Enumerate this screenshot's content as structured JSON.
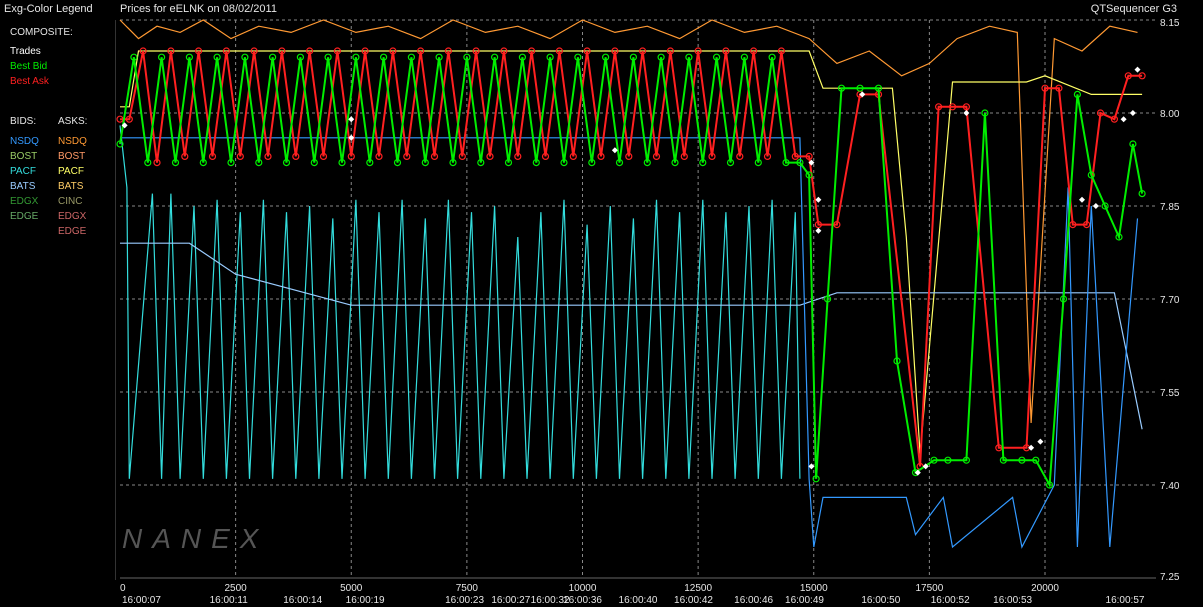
{
  "header": {
    "legend_title": "Exg-Color Legend",
    "chart_title": "Prices for  eELNK  on  08/02/2011",
    "app_name": "QTSequencer G3"
  },
  "legend": {
    "composite_heading": "COMPOSITE:",
    "composite": [
      {
        "label": "Trades",
        "color": "#ffffff"
      },
      {
        "label": "Best Bid",
        "color": "#00ee00"
      },
      {
        "label": "Best Ask",
        "color": "#ff2020"
      }
    ],
    "bids_heading": "BIDS:",
    "asks_heading": "ASKS:",
    "bids": [
      {
        "label": "NSDQ",
        "color": "#3399ff"
      },
      {
        "label": "BOST",
        "color": "#99cc66"
      },
      {
        "label": "PACF",
        "color": "#33dddd"
      },
      {
        "label": "BATS",
        "color": "#99ccff"
      },
      {
        "label": "EDGX",
        "color": "#339933"
      },
      {
        "label": "EDGE",
        "color": "#66aa66"
      }
    ],
    "asks": [
      {
        "label": "NSDQ",
        "color": "#ff9933"
      },
      {
        "label": "BOST",
        "color": "#ff9966"
      },
      {
        "label": "PACF",
        "color": "#ffff66"
      },
      {
        "label": "BATS",
        "color": "#ffcc66"
      },
      {
        "label": "CINC",
        "color": "#999966"
      },
      {
        "label": "EDGX",
        "color": "#cc6666"
      },
      {
        "label": "EDGE",
        "color": "#cc6666"
      }
    ]
  },
  "watermark": "NANEX",
  "chart_data": {
    "type": "line",
    "xlim": [
      0,
      22400
    ],
    "ylim": [
      7.25,
      8.15
    ],
    "grid": true,
    "x_ticks": [
      {
        "x": 0,
        "label": "0"
      },
      {
        "x": 2500,
        "label": "2500"
      },
      {
        "x": 5000,
        "label": "5000"
      },
      {
        "x": 7500,
        "label": "7500"
      },
      {
        "x": 10000,
        "label": "10000"
      },
      {
        "x": 12500,
        "label": "12500"
      },
      {
        "x": 15000,
        "label": "15000"
      },
      {
        "x": 17500,
        "label": "17500"
      },
      {
        "x": 20000,
        "label": "20000"
      }
    ],
    "time_ticks": [
      {
        "x": 0,
        "label": "16:00:07"
      },
      {
        "x": 2350,
        "label": "16:00:11"
      },
      {
        "x": 3950,
        "label": "16:00:14"
      },
      {
        "x": 5300,
        "label": "16:00:19"
      },
      {
        "x": 7450,
        "label": "16:00:23"
      },
      {
        "x": 8450,
        "label": "16:00:27"
      },
      {
        "x": 9300,
        "label": "16:00:32"
      },
      {
        "x": 10000,
        "label": "16:00:36"
      },
      {
        "x": 11200,
        "label": "16:00:40"
      },
      {
        "x": 12400,
        "label": "16:00:42"
      },
      {
        "x": 13700,
        "label": "16:00:46"
      },
      {
        "x": 14800,
        "label": "16:00:49"
      },
      {
        "x": 16450,
        "label": "16:00:50"
      },
      {
        "x": 17950,
        "label": "16:00:52"
      },
      {
        "x": 19300,
        "label": "16:00:53"
      },
      {
        "x": 22000,
        "label": "16:00:57"
      }
    ],
    "y_ticks": [
      {
        "y": 8.15,
        "label": "8.15"
      },
      {
        "y": 8.0,
        "label": "8.00"
      },
      {
        "y": 7.85,
        "label": "7.85"
      },
      {
        "y": 7.7,
        "label": "7.70"
      },
      {
        "y": 7.55,
        "label": "7.55"
      },
      {
        "y": 7.4,
        "label": "7.40"
      },
      {
        "y": 7.25,
        "label": "7.25"
      }
    ],
    "series": [
      {
        "name": "Best Bid",
        "color": "#00ee00",
        "x": [
          0,
          300,
          600,
          900,
          1200,
          1500,
          1800,
          2100,
          2400,
          2700,
          3000,
          3300,
          3600,
          3900,
          4200,
          4500,
          4800,
          5100,
          5400,
          5700,
          6000,
          6300,
          6600,
          6900,
          7200,
          7500,
          7800,
          8100,
          8400,
          8700,
          9000,
          9300,
          9600,
          9900,
          10200,
          10500,
          10800,
          11100,
          11400,
          11700,
          12000,
          12300,
          12600,
          12900,
          13200,
          13500,
          13800,
          14100,
          14400,
          14700,
          14900,
          15050,
          15300,
          15600,
          16000,
          16400,
          16800,
          17200,
          17600,
          17900,
          18300,
          18700,
          19100,
          19500,
          19800,
          20100,
          20400,
          20700,
          21000,
          21300,
          21600,
          21900,
          22100
        ],
        "values": [
          7.95,
          8.09,
          7.92,
          8.09,
          7.92,
          8.09,
          7.92,
          8.09,
          7.92,
          8.09,
          7.92,
          8.09,
          7.92,
          8.09,
          7.92,
          8.09,
          7.92,
          8.09,
          7.92,
          8.09,
          7.92,
          8.09,
          7.92,
          8.09,
          7.92,
          8.09,
          7.92,
          8.09,
          7.92,
          8.09,
          7.92,
          8.09,
          7.92,
          8.09,
          7.92,
          8.09,
          7.92,
          8.09,
          7.92,
          8.09,
          7.92,
          8.09,
          7.92,
          8.09,
          7.92,
          8.09,
          7.92,
          8.09,
          7.92,
          7.92,
          7.9,
          7.41,
          7.7,
          8.04,
          8.04,
          8.04,
          7.6,
          7.42,
          7.44,
          7.44,
          7.44,
          8.0,
          7.44,
          7.44,
          7.44,
          7.4,
          7.7,
          8.03,
          7.9,
          7.85,
          7.8,
          7.95,
          7.87
        ]
      },
      {
        "name": "Best Ask",
        "color": "#ff2020",
        "x": [
          0,
          200,
          500,
          800,
          1100,
          1400,
          1700,
          2000,
          2300,
          2600,
          2900,
          3200,
          3500,
          3800,
          4100,
          4400,
          4700,
          5000,
          5300,
          5600,
          5900,
          6200,
          6500,
          6800,
          7100,
          7400,
          7700,
          8000,
          8300,
          8600,
          8900,
          9200,
          9500,
          9800,
          10100,
          10400,
          10700,
          11000,
          11300,
          11600,
          11900,
          12200,
          12500,
          12800,
          13100,
          13400,
          13700,
          14000,
          14300,
          14600,
          14900,
          15100,
          15500,
          16000,
          16400,
          17300,
          17700,
          18000,
          18300,
          19000,
          19600,
          20000,
          20300,
          20600,
          20900,
          21200,
          21500,
          21800,
          22100
        ],
        "values": [
          7.99,
          7.99,
          8.1,
          7.92,
          8.1,
          7.93,
          8.1,
          7.93,
          8.1,
          7.93,
          8.1,
          7.93,
          8.1,
          7.93,
          8.1,
          7.93,
          8.1,
          7.93,
          8.1,
          7.93,
          8.1,
          7.93,
          8.1,
          7.93,
          8.1,
          7.93,
          8.1,
          7.93,
          8.1,
          7.93,
          8.1,
          7.93,
          8.1,
          7.93,
          8.1,
          7.93,
          8.1,
          7.93,
          8.1,
          7.93,
          8.1,
          7.93,
          8.1,
          7.93,
          8.1,
          7.93,
          8.1,
          7.93,
          8.1,
          7.93,
          7.93,
          7.82,
          7.82,
          8.03,
          8.03,
          7.43,
          8.01,
          8.01,
          8.01,
          7.46,
          7.46,
          8.04,
          8.04,
          7.82,
          7.82,
          8.0,
          7.99,
          8.06,
          8.06
        ]
      },
      {
        "name": "PACF",
        "color": "#33dddd",
        "x": [
          0,
          150,
          200,
          700,
          900,
          1100,
          1300,
          1600,
          1800,
          2100,
          2300,
          2600,
          2800,
          3100,
          3300,
          3600,
          3800,
          4100,
          4300,
          4600,
          4800,
          5100,
          5300,
          5600,
          5800,
          6100,
          6300,
          6600,
          6800,
          7100,
          7300,
          7600,
          7800,
          8100,
          8300,
          8600,
          8800,
          9100,
          9300,
          9600,
          9800,
          10100,
          10300,
          10600,
          10800,
          11100,
          11300,
          11600,
          11800,
          12100,
          12300,
          12600,
          12800,
          13100,
          13300,
          13600,
          13800,
          14100,
          14300,
          14600,
          14700
        ],
        "values": [
          7.98,
          7.88,
          7.41,
          7.87,
          7.41,
          7.87,
          7.41,
          7.85,
          7.41,
          7.86,
          7.41,
          7.84,
          7.41,
          7.86,
          7.41,
          7.84,
          7.41,
          7.85,
          7.41,
          7.83,
          7.41,
          7.86,
          7.41,
          7.84,
          7.41,
          7.86,
          7.41,
          7.83,
          7.41,
          7.86,
          7.41,
          7.84,
          7.41,
          7.85,
          7.41,
          7.8,
          7.41,
          7.84,
          7.41,
          7.86,
          7.41,
          7.82,
          7.41,
          7.85,
          7.41,
          7.83,
          7.41,
          7.86,
          7.41,
          7.84,
          7.41,
          7.86,
          7.41,
          7.84,
          7.41,
          7.85,
          7.41,
          7.86,
          7.41,
          7.84,
          7.41
        ]
      },
      {
        "name": "NSDQ Ask",
        "color": "#ff9933",
        "x": [
          0,
          400,
          800,
          1300,
          1800,
          2400,
          3000,
          3700,
          4400,
          5100,
          5800,
          6500,
          7200,
          7900,
          8600,
          9300,
          10000,
          10700,
          11400,
          12100,
          12800,
          13500,
          14200,
          14900,
          15500,
          16200,
          16900,
          17500,
          18100,
          18800,
          19400,
          19700,
          20200,
          20800,
          21400,
          22000
        ],
        "values": [
          8.15,
          8.12,
          8.14,
          8.13,
          8.15,
          8.12,
          8.14,
          8.13,
          8.15,
          8.13,
          8.14,
          8.12,
          8.15,
          8.13,
          8.14,
          8.12,
          8.15,
          8.13,
          8.14,
          8.12,
          8.15,
          8.13,
          8.14,
          8.12,
          8.08,
          8.1,
          8.06,
          8.08,
          8.12,
          8.14,
          8.13,
          7.5,
          8.12,
          8.1,
          8.14,
          8.13
        ]
      },
      {
        "name": "PACF Ask",
        "color": "#ffff66",
        "x": [
          0,
          200,
          400,
          14900,
          15200,
          16000,
          16700,
          17000,
          17300,
          18000,
          19000,
          19600,
          20000,
          21000,
          22100
        ],
        "values": [
          8.01,
          8.01,
          8.1,
          8.1,
          8.04,
          8.04,
          8.04,
          7.8,
          7.45,
          8.05,
          8.05,
          8.05,
          8.06,
          8.03,
          8.03
        ]
      },
      {
        "name": "NSDQ Bid",
        "color": "#3399ff",
        "x": [
          0,
          14700,
          14900,
          15000,
          15200,
          17000,
          17200,
          17800,
          18000,
          19300,
          19500,
          20200,
          20500,
          20700,
          21000,
          21400,
          22000
        ],
        "values": [
          7.96,
          7.96,
          7.41,
          7.3,
          7.38,
          7.38,
          7.32,
          7.38,
          7.3,
          7.38,
          7.3,
          7.4,
          7.88,
          7.3,
          7.85,
          7.3,
          7.83
        ]
      },
      {
        "name": "BATS",
        "color": "#99ccff",
        "x": [
          0,
          1500,
          2500,
          5000,
          7500,
          10000,
          12500,
          14700,
          15500,
          17500,
          20000,
          21500,
          22100
        ],
        "values": [
          7.79,
          7.79,
          7.74,
          7.69,
          7.69,
          7.69,
          7.69,
          7.69,
          7.71,
          7.71,
          7.71,
          7.71,
          7.49
        ]
      }
    ],
    "trades": {
      "name": "Trades",
      "color": "#ffffff",
      "x": [
        100,
        5000,
        5000,
        10700,
        14950,
        15100,
        15100,
        14950,
        16050,
        17250,
        17420,
        18300,
        19700,
        19900,
        20800,
        21100,
        21700,
        21900,
        22000
      ],
      "values": [
        7.98,
        7.99,
        7.96,
        7.94,
        7.92,
        7.86,
        7.81,
        7.43,
        8.03,
        7.42,
        7.43,
        8.0,
        7.46,
        7.47,
        7.86,
        7.85,
        7.99,
        8.0,
        8.07
      ]
    }
  }
}
